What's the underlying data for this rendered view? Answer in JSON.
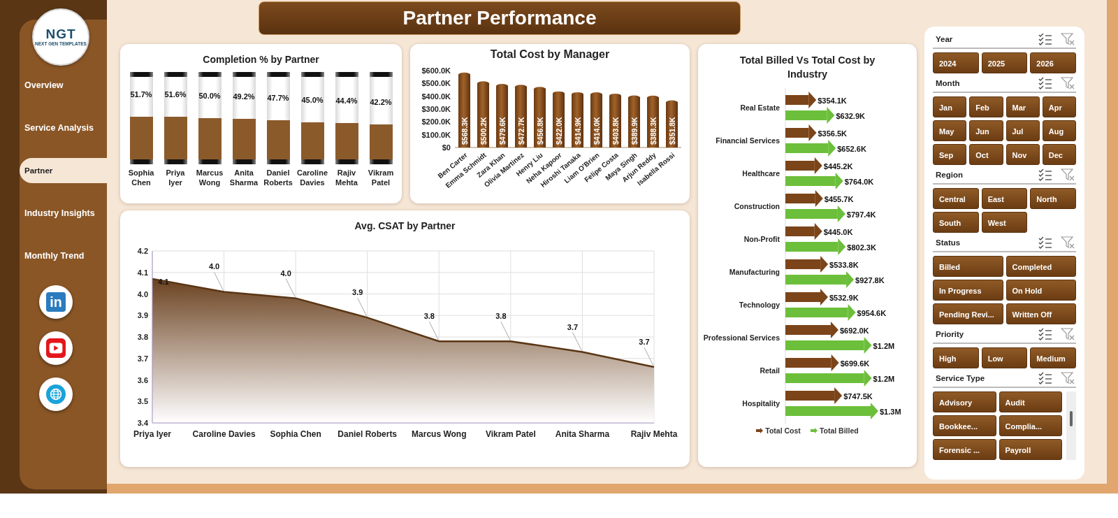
{
  "title": "Partner Performance",
  "sidebar": {
    "logo": {
      "text": "NGT",
      "tagline": "NEXT GEN TEMPLATES"
    },
    "items": [
      {
        "label": "Overview",
        "selected": false
      },
      {
        "label": "Service Analysis",
        "selected": false
      },
      {
        "label": "Partner",
        "selected": true
      },
      {
        "label": "Industry Insights",
        "selected": false
      },
      {
        "label": "Monthly Trend",
        "selected": false
      }
    ],
    "social": [
      {
        "kind": "linkedin",
        "glyph": "in"
      },
      {
        "kind": "youtube"
      },
      {
        "kind": "web"
      }
    ]
  },
  "completion": {
    "chart_data": {
      "type": "bar",
      "title": "Completion % by Partner",
      "categories": [
        "Sophia Chen",
        "Priya Iyer",
        "Marcus Wong",
        "Anita Sharma",
        "Daniel Roberts",
        "Caroline Davies",
        "Rajiv Mehta",
        "Vikram Patel"
      ],
      "values": [
        51.7,
        51.6,
        50.0,
        49.2,
        47.7,
        45.0,
        44.4,
        42.2
      ],
      "value_labels": [
        "51.7%",
        "51.6%",
        "50.0%",
        "49.2%",
        "47.7%",
        "45.0%",
        "44.4%",
        "42.2%"
      ]
    }
  },
  "cost": {
    "chart_data": {
      "type": "bar",
      "title": "Total Cost by Manager",
      "categories": [
        "Ben Carter",
        "Emma Schmidt",
        "Zara Khan",
        "Olivia Martinez",
        "Henry Liu",
        "Neha Kapoor",
        "Hiroshi Tanaka",
        "Liam O'Brien",
        "Felipe Costa",
        "Maya Singh",
        "Arjun Reddy",
        "Isabella Rossi"
      ],
      "values": [
        568300,
        500200,
        479600,
        472700,
        456800,
        422000,
        414900,
        414000,
        403800,
        389900,
        388300,
        351800
      ],
      "ylim": [
        0,
        600000
      ],
      "yticks": [
        {
          "value": 0,
          "label": "$0"
        },
        {
          "value": 100000,
          "label": "$100.0K"
        },
        {
          "value": 200000,
          "label": "$200.0K"
        },
        {
          "value": 300000,
          "label": "$300.0K"
        },
        {
          "value": 400000,
          "label": "$400.0K"
        },
        {
          "value": 500000,
          "label": "$500.0K"
        },
        {
          "value": 600000,
          "label": "$600.0K"
        }
      ],
      "value_labels": [
        "$568.3K",
        "$500.2K",
        "$479.6K",
        "$472.7K",
        "$456.8K",
        "$422.0K",
        "$414.9K",
        "$414.0K",
        "$403.8K",
        "$389.9K",
        "$388.3K",
        "$351.8K"
      ]
    }
  },
  "billed": {
    "chart_data": {
      "type": "bar",
      "orientation": "horizontal",
      "data_labels": true,
      "title": "Total Billed Vs Total Cost by Industry",
      "categories": [
        "Real Estate",
        "Financial Services",
        "Healthcare",
        "Construction",
        "Non-Profit",
        "Manufacturing",
        "Technology",
        "Professional Services",
        "Retail",
        "Hospitality"
      ],
      "series": [
        {
          "name": "Total Cost",
          "color": "#7b4419",
          "values": [
            354100,
            356500,
            445200,
            455700,
            445000,
            533800,
            532900,
            692000,
            699600,
            747500
          ],
          "value_labels": [
            "$354.1K",
            "$356.5K",
            "$445.2K",
            "$455.7K",
            "$445.0K",
            "$533.8K",
            "$532.9K",
            "$692.0K",
            "$699.6K",
            "$747.5K"
          ]
        },
        {
          "name": "Total Billed",
          "color": "#6cbf3a",
          "values": [
            632900,
            652600,
            764000,
            797400,
            802300,
            927800,
            954600,
            1200000,
            1200000,
            1300000
          ],
          "value_labels": [
            "$632.9K",
            "$652.6K",
            "$764.0K",
            "$797.4K",
            "$802.3K",
            "$927.8K",
            "$954.6K",
            "$1.2M",
            "$1.2M",
            "$1.3M"
          ]
        }
      ]
    }
  },
  "csat": {
    "chart_data": {
      "type": "area",
      "grid": true,
      "title": "Avg. CSAT by Partner",
      "categories": [
        "Priya Iyer",
        "Caroline Davies",
        "Sophia Chen",
        "Daniel Roberts",
        "Marcus Wong",
        "Vikram Patel",
        "Anita Sharma",
        "Rajiv Mehta"
      ],
      "values": [
        4.07,
        4.01,
        3.98,
        3.89,
        3.78,
        3.78,
        3.73,
        3.66
      ],
      "ylim": [
        3.4,
        4.2
      ],
      "yticks": [
        {
          "value": 3.4,
          "label": "3.4"
        },
        {
          "value": 3.5,
          "label": "3.5"
        },
        {
          "value": 3.6,
          "label": "3.6"
        },
        {
          "value": 3.7,
          "label": "3.7"
        },
        {
          "value": 3.8,
          "label": "3.8"
        },
        {
          "value": 3.9,
          "label": "3.9"
        },
        {
          "value": 4.0,
          "label": "4.0"
        },
        {
          "value": 4.1,
          "label": "4.1"
        },
        {
          "value": 4.2,
          "label": "4.2"
        }
      ],
      "value_labels": [
        "4.1",
        "4.0",
        "4.0",
        "3.9",
        "3.8",
        "3.8",
        "3.7",
        "3.7"
      ]
    }
  },
  "slicers": [
    {
      "title": "Year",
      "items": [
        {
          "label": "2024",
          "selected": true
        },
        {
          "label": "2025",
          "selected": true
        },
        {
          "label": "2026",
          "selected": true
        }
      ]
    },
    {
      "title": "Month",
      "items": [
        {
          "label": "Jan",
          "selected": true
        },
        {
          "label": "Feb",
          "selected": true
        },
        {
          "label": "Mar",
          "selected": true
        },
        {
          "label": "Apr",
          "selected": true
        },
        {
          "label": "May",
          "selected": true
        },
        {
          "label": "Jun",
          "selected": true
        },
        {
          "label": "Jul",
          "selected": true
        },
        {
          "label": "Aug",
          "selected": true
        },
        {
          "label": "Sep",
          "selected": true
        },
        {
          "label": "Oct",
          "selected": true
        },
        {
          "label": "Nov",
          "selected": true
        },
        {
          "label": "Dec",
          "selected": true
        }
      ]
    },
    {
      "title": "Region",
      "items": [
        {
          "label": "Central",
          "selected": true
        },
        {
          "label": "East",
          "selected": true
        },
        {
          "label": "North",
          "selected": true
        },
        {
          "label": "South",
          "selected": true
        },
        {
          "label": "West",
          "selected": true
        }
      ]
    },
    {
      "title": "Status",
      "items": [
        {
          "label": "Billed",
          "selected": true
        },
        {
          "label": "Completed",
          "selected": true
        },
        {
          "label": "In Progress",
          "selected": true
        },
        {
          "label": "On Hold",
          "selected": true
        },
        {
          "label": "Pending Revi...",
          "selected": true
        },
        {
          "label": "Written Off",
          "selected": true
        }
      ]
    },
    {
      "title": "Priority",
      "items": [
        {
          "label": "High",
          "selected": true
        },
        {
          "label": "Low",
          "selected": true
        },
        {
          "label": "Medium",
          "selected": true
        }
      ]
    },
    {
      "title": "Service Type",
      "scrollable": true,
      "items": [
        {
          "label": "Advisory",
          "selected": true
        },
        {
          "label": "Audit",
          "selected": true
        },
        {
          "label": "Bookkee...",
          "selected": true
        },
        {
          "label": "Complia...",
          "selected": true
        },
        {
          "label": "Forensic ...",
          "selected": true
        },
        {
          "label": "Payroll",
          "selected": true
        }
      ]
    }
  ]
}
